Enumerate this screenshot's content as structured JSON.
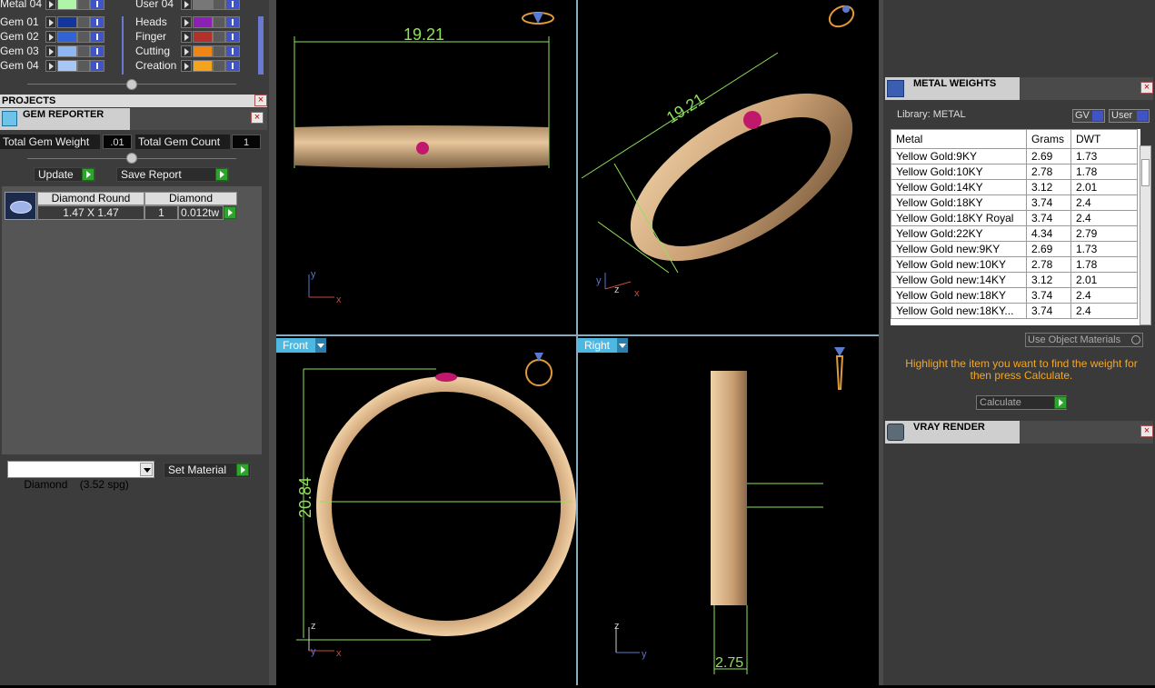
{
  "layers": {
    "left": [
      {
        "label": "Metal 04",
        "color": "#aef5a8"
      },
      {
        "label": "Gem 01",
        "color": "#12369e"
      },
      {
        "label": "Gem 02",
        "color": "#2f63d6"
      },
      {
        "label": "Gem 03",
        "color": "#8fb6f2"
      },
      {
        "label": "Gem 04",
        "color": "#a7c8f6"
      }
    ],
    "right": [
      {
        "label": "User 04",
        "color": "#777777"
      },
      {
        "label": "Heads",
        "color": "#8d1fb4"
      },
      {
        "label": "Finger",
        "color": "#b3312a"
      },
      {
        "label": "Cutting",
        "color": "#f08414"
      },
      {
        "label": "Creation",
        "color": "#f5a31a"
      }
    ]
  },
  "projects": {
    "title": "PROJECTS"
  },
  "gem_reporter": {
    "title": "GEM REPORTER",
    "total_weight_label": "Total Gem Weight",
    "total_weight_value": ".01",
    "total_count_label": "Total Gem Count",
    "total_count_value": "1",
    "update_label": "Update",
    "save_report_label": "Save Report",
    "gem": {
      "name": "Diamond Round",
      "size": "1.47 X 1.47",
      "material": "Diamond",
      "count": "1",
      "weight": "0.012tw"
    },
    "material_select": "Diamond    (3.52 spg)",
    "set_material_label": "Set Material"
  },
  "viewports": {
    "top_left_dim": "19.21",
    "top_right_dim": "19.21",
    "front": {
      "tag": "Front",
      "dim": "20.84"
    },
    "right": {
      "tag": "Right",
      "dim": "2.75"
    }
  },
  "metal_weights": {
    "title": "METAL WEIGHTS",
    "library": "Library: METAL",
    "gv_label": "GV",
    "user_label": "User",
    "headers": [
      "Metal",
      "Grams",
      "DWT"
    ],
    "rows": [
      [
        "Yellow Gold:9KY",
        "2.69",
        "1.73"
      ],
      [
        "Yellow Gold:10KY",
        "2.78",
        "1.78"
      ],
      [
        "Yellow Gold:14KY",
        "3.12",
        "2.01"
      ],
      [
        "Yellow Gold:18KY",
        "3.74",
        "2.4"
      ],
      [
        "Yellow Gold:18KY Royal",
        "3.74",
        "2.4"
      ],
      [
        "Yellow Gold:22KY",
        "4.34",
        "2.79"
      ],
      [
        "Yellow Gold new:9KY",
        "2.69",
        "1.73"
      ],
      [
        "Yellow Gold new:10KY",
        "2.78",
        "1.78"
      ],
      [
        "Yellow Gold new:14KY",
        "3.12",
        "2.01"
      ],
      [
        "Yellow Gold new:18KY",
        "3.74",
        "2.4"
      ],
      [
        "Yellow Gold new:18KY...",
        "3.74",
        "2.4"
      ]
    ],
    "use_object_materials": "Use Object Materials",
    "hint": "Highlight the item you want to find the weight for then press Calculate.",
    "calculate_label": "Calculate"
  },
  "vray": {
    "title": "VRAY RENDER"
  }
}
